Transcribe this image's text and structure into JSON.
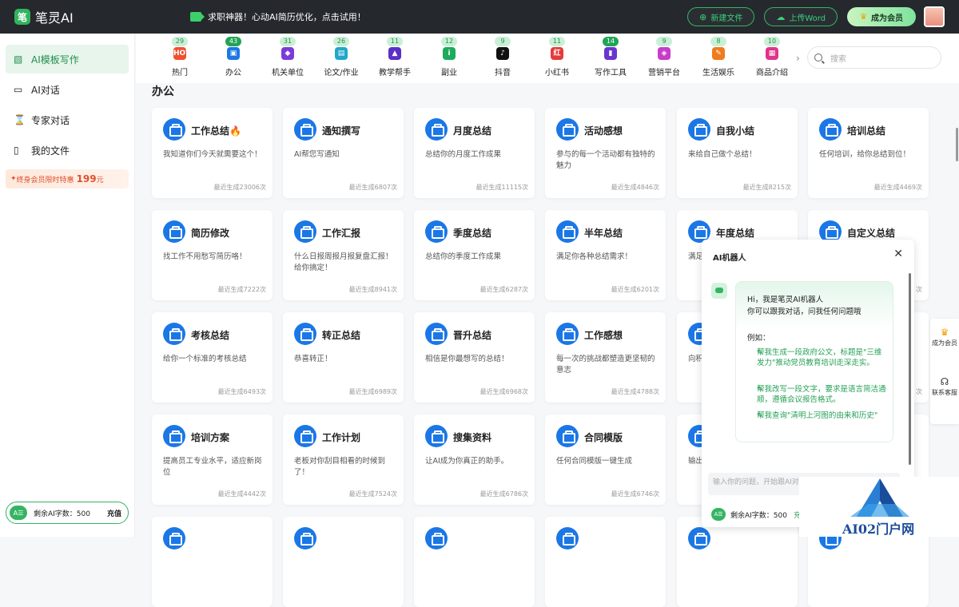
{
  "app": {
    "logo_text": "笔灵AI",
    "logo_mark": "笔"
  },
  "promo": {
    "text": "求职神器！心动AI简历优化，点击试用！"
  },
  "top_actions": {
    "new_file": "新建文件",
    "upload_word": "上传Word",
    "vip": "成为会员"
  },
  "sidebar": {
    "items": [
      {
        "label": "AI模板写作",
        "icon": "template-icon",
        "active": true
      },
      {
        "label": "AI对话",
        "icon": "chat-icon",
        "active": false
      },
      {
        "label": "专家对话",
        "icon": "expert-icon",
        "active": false
      },
      {
        "label": "我的文件",
        "icon": "file-icon",
        "active": false
      }
    ],
    "promo_prefix": "终身会员限时特惠",
    "promo_price": "199",
    "promo_unit": "元",
    "quota_badge": "A☰",
    "quota_label": "剩余AI字数：500",
    "recharge": "充值"
  },
  "categories": [
    {
      "label": "热门",
      "count": "29",
      "icon_text": "HOT",
      "color": "#f0502e",
      "highlight": false
    },
    {
      "label": "办公",
      "count": "43",
      "icon_text": "▣",
      "color": "#1b77e6",
      "highlight": true
    },
    {
      "label": "机关单位",
      "count": "31",
      "icon_text": "◆",
      "color": "#7c3bd9",
      "highlight": false
    },
    {
      "label": "论文/作业",
      "count": "26",
      "icon_text": "▤",
      "color": "#22a6c9",
      "highlight": false
    },
    {
      "label": "教学帮手",
      "count": "11",
      "icon_text": "▲",
      "color": "#5a2fc8",
      "highlight": false
    },
    {
      "label": "副业",
      "count": "12",
      "icon_text": "i",
      "color": "#1dab5c",
      "highlight": false
    },
    {
      "label": "抖音",
      "count": "9",
      "icon_text": "♪",
      "color": "#111111",
      "highlight": false
    },
    {
      "label": "小红书",
      "count": "11",
      "icon_text": "红",
      "color": "#e53a3a",
      "highlight": false
    },
    {
      "label": "写作工具",
      "count": "14",
      "icon_text": "▮",
      "color": "#6a35d1",
      "highlight": true
    },
    {
      "label": "营销平台",
      "count": "9",
      "icon_text": "◈",
      "color": "#c83cc8",
      "highlight": false
    },
    {
      "label": "生活娱乐",
      "count": "8",
      "icon_text": "✎",
      "color": "#f07a1e",
      "highlight": false
    },
    {
      "label": "商品介绍",
      "count": "10",
      "icon_text": "▦",
      "color": "#e0338a",
      "highlight": false
    }
  ],
  "search": {
    "placeholder": "搜索"
  },
  "section": {
    "title": "办公"
  },
  "cards": [
    {
      "title": "工作总结🔥",
      "desc": "我知道你们今天就需要这个！",
      "footer": "最近生成23006次"
    },
    {
      "title": "通知撰写",
      "desc": "AI帮您写通知",
      "footer": "最近生成6807次"
    },
    {
      "title": "月度总结",
      "desc": "总结你的月度工作成果",
      "footer": "最近生成11115次"
    },
    {
      "title": "活动感想",
      "desc": "参与的每一个活动都有独特的魅力",
      "footer": "最近生成4846次"
    },
    {
      "title": "自我小结",
      "desc": "来给自己做个总结！",
      "footer": "最近生成8215次"
    },
    {
      "title": "培训总结",
      "desc": "任何培训，给你总结到位！",
      "footer": "最近生成4469次"
    },
    {
      "title": "简历修改",
      "desc": "找工作不用愁写简历咯！",
      "footer": "最近生成7222次"
    },
    {
      "title": "工作汇报",
      "desc": "什么日报周报月报复盘汇报！给你搞定！",
      "footer": "最近生成8941次"
    },
    {
      "title": "季度总结",
      "desc": "总结你的季度工作成果",
      "footer": "最近生成6287次"
    },
    {
      "title": "半年总结",
      "desc": "满足你各种总结需求！",
      "footer": "最近生成6201次"
    },
    {
      "title": "年度总结",
      "desc": "满足",
      "footer": ""
    },
    {
      "title": "自定义总结",
      "desc": "",
      "footer": "次"
    },
    {
      "title": "考核总结",
      "desc": "给你一个标准的考核总结",
      "footer": "最近生成6493次"
    },
    {
      "title": "转正总结",
      "desc": "恭喜转正！",
      "footer": "最近生成6989次"
    },
    {
      "title": "晋升总结",
      "desc": "相信是你最想写的总结！",
      "footer": "最近生成6968次"
    },
    {
      "title": "工作感想",
      "desc": "每一次的挑战都塑造更坚韧的意志",
      "footer": "最近生成4788次"
    },
    {
      "title": "",
      "desc": "向积一个",
      "footer": ""
    },
    {
      "title": "",
      "desc": "",
      "footer": "次"
    },
    {
      "title": "培训方案",
      "desc": "提高员工专业水平，适应新岗位",
      "footer": "最近生成4442次"
    },
    {
      "title": "工作计划",
      "desc": "老板对你刮目相看的时候到了！",
      "footer": "最近生成7524次"
    },
    {
      "title": "搜集资料",
      "desc": "让AI成为你真正的助手。",
      "footer": "最近生成6786次"
    },
    {
      "title": "合同模版",
      "desc": "任何合同模版一键生成",
      "footer": "最近生成6746次"
    },
    {
      "title": "",
      "desc": "输出成一",
      "footer": ""
    },
    {
      "title": "",
      "desc": "",
      "footer": ""
    }
  ],
  "float_side": {
    "vip": "成为会员",
    "service": "联系客服"
  },
  "chat": {
    "title": "AI机器人",
    "greeting1": "Hi，我是笔灵AI机器人",
    "greeting2": "你可以跟我对话，问我任何问题哦",
    "examples_label": "例如：",
    "examples": [
      "帮我生成一段政府公文，标题是\"三维发力\"推动党员教育培训走深走实。",
      "帮我改写一段文字，要求是语言简洁通顺，遵循会议报告格式。",
      "帮我查询\"清明上河图的由来和历史\""
    ],
    "input_placeholder": "输入你的问题，开始跟AI对话",
    "quota_badge": "A☰",
    "quota_label": "剩余AI字数：500",
    "recharge": "充"
  },
  "watermark": {
    "text": "AI02门户网"
  }
}
